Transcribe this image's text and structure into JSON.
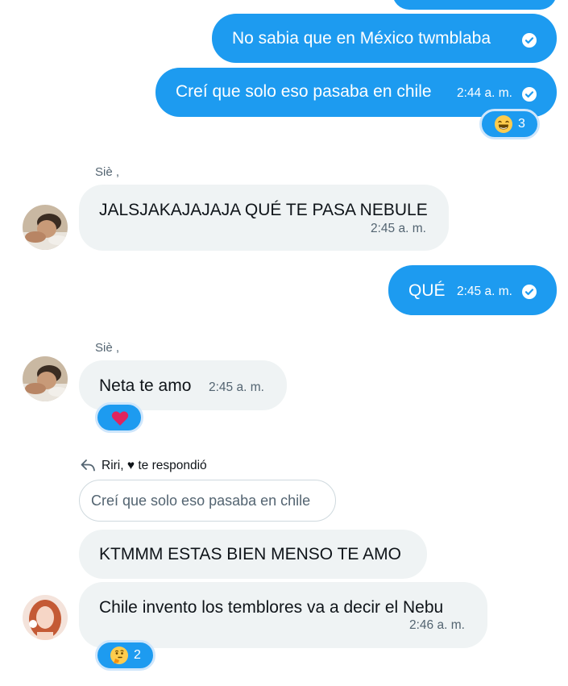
{
  "messages": [
    {
      "id": "m1",
      "text": "No sabia que en México twmblaba",
      "time": ""
    },
    {
      "id": "m2",
      "text": "Creí que solo eso pasaba en chile",
      "time": "2:44 a. m.",
      "reaction_count": "3"
    },
    {
      "id": "m3",
      "sender": "Siè ,",
      "text": "JALSJAKAJAJAJA QUÉ TE PASA NEBULE",
      "time": "2:45 a. m."
    },
    {
      "id": "m4",
      "text": "QUÉ",
      "time": "2:45 a. m."
    },
    {
      "id": "m5",
      "sender": "Siè ,",
      "text": "Neta te amo",
      "time": "2:45 a. m."
    },
    {
      "id": "m6",
      "reply_header": "Riri, ♥ te respondió",
      "quoted": "Creí que solo eso pasaba en chile",
      "text": "KTMMM ESTAS BIEN MENSO TE AMO"
    },
    {
      "id": "m7",
      "text": "Chile invento los temblores va a decir el Nebu",
      "time": "2:46 a. m.",
      "reaction_count": "2"
    }
  ],
  "icons": {
    "sent": "check-circle-icon",
    "reply": "reply-arrow-icon",
    "reaction_laugh": "laughing-face-icon",
    "reaction_heart": "heart-icon",
    "reaction_think": "thinking-face-icon"
  },
  "colors": {
    "outgoing": "#1d9bf0",
    "incoming": "#eff3f4",
    "muted": "#536471"
  }
}
